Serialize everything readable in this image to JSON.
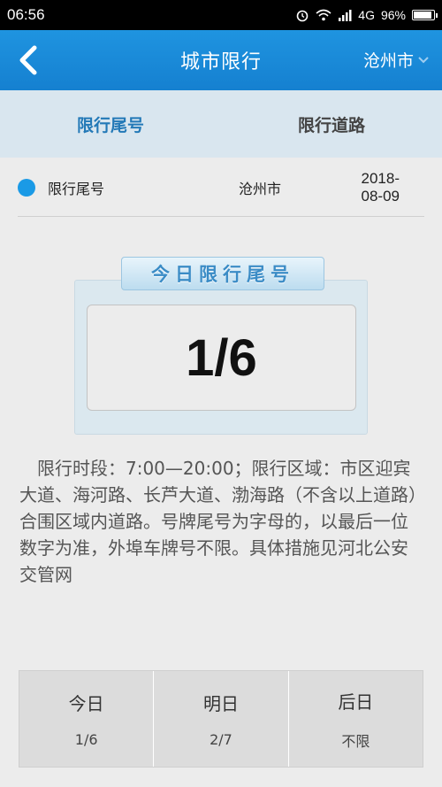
{
  "status_bar": {
    "time": "06:56",
    "network": "4G",
    "battery": "96%",
    "battery_level": 0.96
  },
  "app_bar": {
    "title": "城市限行",
    "city": "沧州市"
  },
  "tabs": [
    {
      "label": "限行尾号",
      "active": true
    },
    {
      "label": "限行道路",
      "active": false
    }
  ],
  "info": {
    "label": "限行尾号",
    "city": "沧州市",
    "date": "2018-08-09"
  },
  "card": {
    "header": "今日限行尾号",
    "number": "1/6"
  },
  "description": "限行时段：7:00—20:00；限行区域：市区迎宾大道、海河路、长芦大道、渤海路（不含以上道路）合围区域内道路。号牌尾号为字母的，以最后一位数字为准，外埠车牌号不限。具体措施见河北公安交管网",
  "days": [
    {
      "name": "今日",
      "value": "1/6"
    },
    {
      "name": "明日",
      "value": "2/7"
    },
    {
      "name": "后日",
      "value": "不限"
    }
  ],
  "colors": {
    "primary": "#1a8ad8",
    "tab_active": "#2379b7",
    "dot": "#1a9ae6"
  }
}
